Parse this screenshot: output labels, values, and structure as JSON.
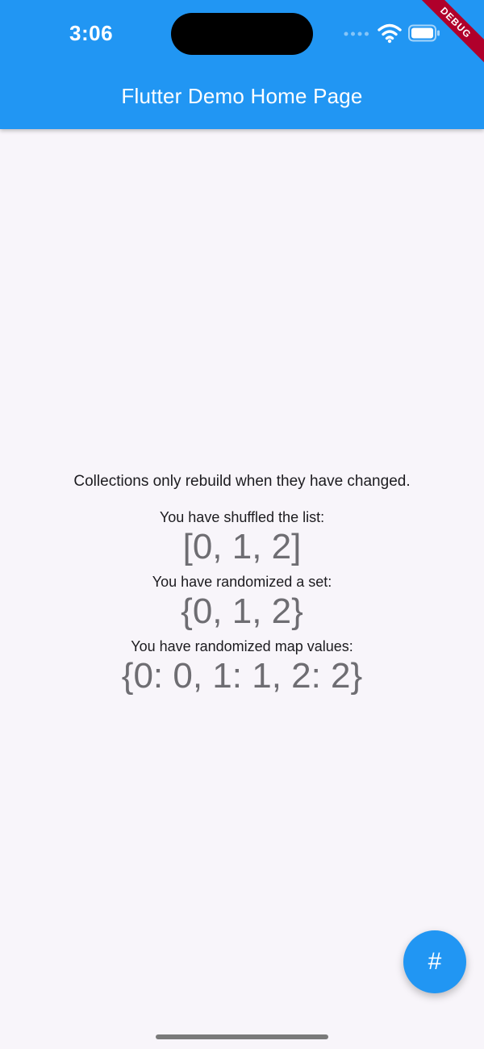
{
  "status_bar": {
    "time": "3:06"
  },
  "app_bar": {
    "title": "Flutter Demo Home Page",
    "color": "#2196f3"
  },
  "debug_banner": {
    "label": "DEBUG"
  },
  "content": {
    "intro": "Collections only rebuild when they have changed.",
    "list_label": "You have shuffled the list:",
    "list_value": "[0, 1, 2]",
    "set_label": "You have randomized a set:",
    "set_value": "{0, 1, 2}",
    "map_label": "You have randomized map values:",
    "map_value": "{0: 0, 1: 1, 2: 2}"
  },
  "fab": {
    "icon": "hash-icon",
    "symbol": "#"
  },
  "icons": {
    "wifi": "wifi-icon",
    "battery": "battery-icon",
    "signal": "signal-dots-icon"
  }
}
